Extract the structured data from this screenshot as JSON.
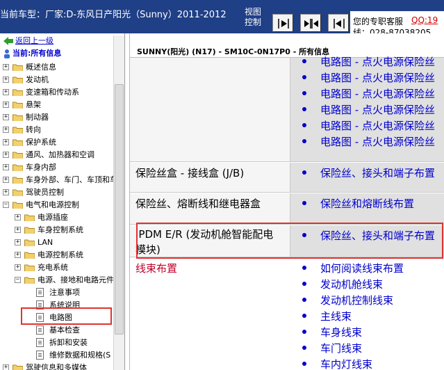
{
  "header": {
    "car_model": "当前车型：厂家:D-东风日产阳光（Sunny）2011-2012",
    "view_control": "视图控制",
    "service_title": "您的专职客服",
    "service_qq": "QQ:19",
    "service_phone": "线：028-87038205",
    "view_buttons": [
      "arrow-right-bar-icon",
      "arrows-in-icon",
      "arrow-left-bar-icon"
    ]
  },
  "tree": {
    "back_label": "返回上一级",
    "current_label": "当前:所有信息",
    "items": [
      {
        "label": "概述信息"
      },
      {
        "label": "发动机"
      },
      {
        "label": "变速箱和传动系"
      },
      {
        "label": "悬架"
      },
      {
        "label": "制动器"
      },
      {
        "label": "转向"
      },
      {
        "label": "保护系统"
      },
      {
        "label": "通风、加热器和空调"
      },
      {
        "label": "车身内部"
      },
      {
        "label": "车身外部、车门、车顶和车"
      },
      {
        "label": "驾驶员控制"
      },
      {
        "label": "电气和电源控制"
      },
      {
        "label": "电源插座"
      },
      {
        "label": "车身控制系统"
      },
      {
        "label": "LAN"
      },
      {
        "label": "电源控制系统"
      },
      {
        "label": "充电系统"
      },
      {
        "label": "电源、接地和电路元件"
      },
      {
        "label": "注意事项"
      },
      {
        "label": "系统说明"
      },
      {
        "label": "电路图"
      },
      {
        "label": "基本检查"
      },
      {
        "label": "拆卸和安装"
      },
      {
        "label": "维修数据和规格(S"
      },
      {
        "label": "驾驶信息和多媒体"
      }
    ]
  },
  "content": {
    "header": "SUNNY(阳光) (N17) - SM10C-0N17P0 - 所有信息",
    "top_links": [
      "电路图 - 点火电源保险丝",
      "电路图 - 点火电源保险丝",
      "电路图 - 点火电源保险丝",
      "电路图 - 点火电源保险丝",
      "电路图 - 点火电源保险丝",
      "电路图 - 点火电源保险丝"
    ],
    "rows": [
      {
        "title": "保险丝盒 - 接线盒 (J/B)",
        "link": "保险丝、接头和端子布置"
      },
      {
        "title": "保险丝、熔断线和继电器盒",
        "link": "保险丝和熔断线布置"
      },
      {
        "title_line1": "IPDM E/R (发动机舱智能配电",
        "title_line2": "模块)",
        "link": "保险丝、接头和端子布置"
      }
    ],
    "harness_title": "线束布置",
    "harness_links": [
      "如何阅读线束布置",
      "发动机舱线束",
      "发动机控制线束",
      "主线束",
      "车身线束",
      "车门线束",
      "车内灯线束"
    ]
  },
  "colors": {
    "topbar": "#1f3f86",
    "link": "#0000cc",
    "highlight_box": "#e0332e",
    "section_red": "#c0002a"
  }
}
